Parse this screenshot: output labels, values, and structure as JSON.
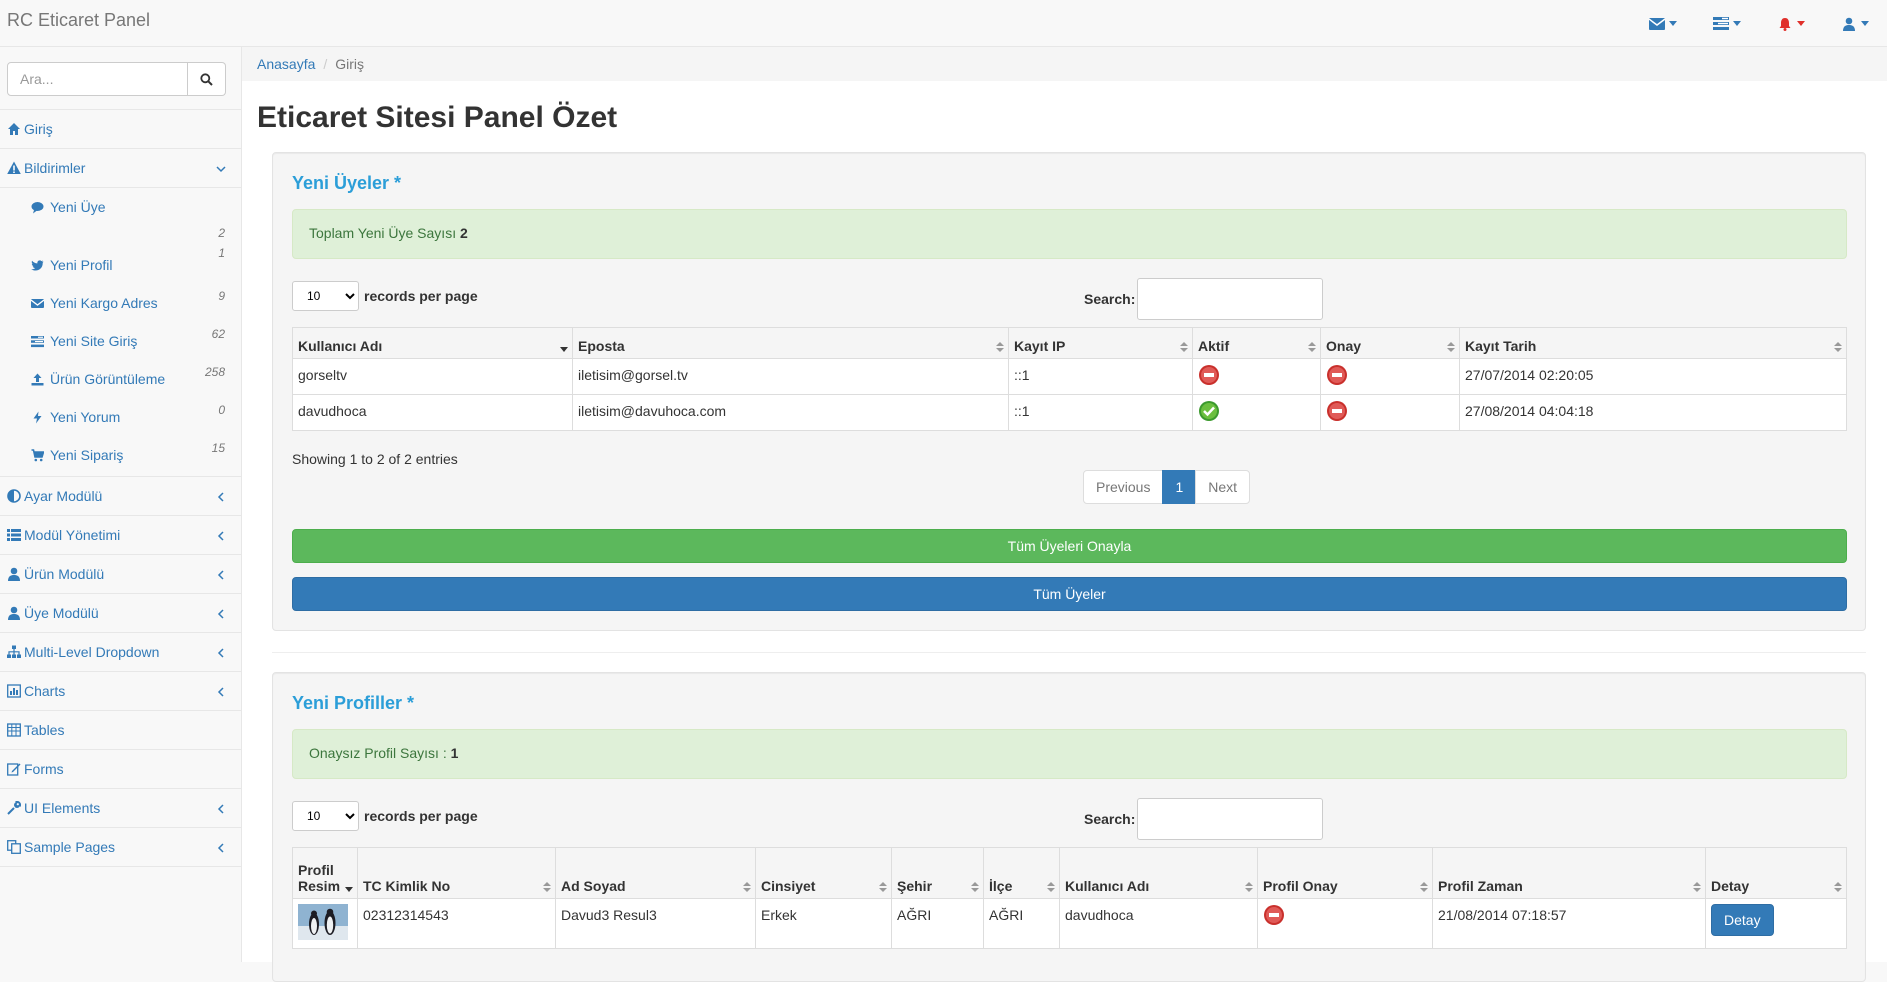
{
  "app": {
    "title": "RC Eticaret Panel"
  },
  "colors": {
    "accent": "#337ab7",
    "success": "#5cb85c",
    "danger": "#d9534f",
    "heading": "#2b9ed8"
  },
  "navbar_icons": [
    "envelope-icon",
    "tasks-icon",
    "bell-icon",
    "user-icon"
  ],
  "sidebar": {
    "search_placeholder": "Ara...",
    "items": [
      {
        "label": "Giriş",
        "icon": "home-icon"
      },
      {
        "label": "Bildirimler",
        "icon": "warning-icon",
        "expanded": true
      },
      {
        "label": "Ayar Modülü",
        "icon": "adjust-icon"
      },
      {
        "label": "Modül Yönetimi",
        "icon": "list-icon"
      },
      {
        "label": "Ürün Modülü",
        "icon": "user-icon"
      },
      {
        "label": "Üye Modülü",
        "icon": "user-icon"
      },
      {
        "label": "Multi-Level Dropdown",
        "icon": "sitemap-icon"
      },
      {
        "label": "Charts",
        "icon": "bar-chart-icon"
      },
      {
        "label": "Tables",
        "icon": "table-icon"
      },
      {
        "label": "Forms",
        "icon": "edit-icon"
      },
      {
        "label": "UI Elements",
        "icon": "wrench-icon"
      },
      {
        "label": "Sample Pages",
        "icon": "files-icon"
      }
    ],
    "notifications": [
      {
        "label": "Yeni Üye",
        "count": "2",
        "icon": "comment-icon"
      },
      {
        "label": "Yeni Profil",
        "count": "1",
        "icon": "twitter-icon"
      },
      {
        "label": "Yeni Kargo Adres",
        "count": "9",
        "icon": "envelope-icon"
      },
      {
        "label": "Yeni Site Giriş",
        "count": "62",
        "icon": "tasks-icon"
      },
      {
        "label": "Ürün Görüntüleme",
        "count": "258",
        "icon": "upload-icon"
      },
      {
        "label": "Yeni Yorum",
        "count": "0",
        "icon": "bolt-icon"
      },
      {
        "label": "Yeni Sipariş",
        "count": "15",
        "icon": "cart-icon"
      }
    ]
  },
  "breadcrumb": {
    "home": "Anasayfa",
    "current": "Giriş"
  },
  "page_title": "Eticaret Sitesi Panel Özet",
  "new_members": {
    "heading": "Yeni Üyeler *",
    "alert_text": "Toplam Yeni Üye Sayısı",
    "alert_count": "2",
    "length_value": "10",
    "length_label": "records per page",
    "search_label": "Search:",
    "columns": [
      "Kullanıcı Adı",
      "Eposta",
      "Kayıt IP",
      "Aktif",
      "Onay",
      "Kayıt Tarih"
    ],
    "rows": [
      {
        "user": "gorseltv",
        "email": "iletisim@gorsel.tv",
        "ip": "::1",
        "active": false,
        "approved": false,
        "date": "27/07/2014 02:20:05"
      },
      {
        "user": "davudhoca",
        "email": "iletisim@davuhoca.com",
        "ip": "::1",
        "active": true,
        "approved": false,
        "date": "27/08/2014 04:04:18"
      }
    ],
    "info": "Showing 1 to 2 of 2 entries",
    "pager": {
      "prev": "Previous",
      "page": "1",
      "next": "Next"
    },
    "approve_all": "Tüm Üyeleri Onayla",
    "all_members": "Tüm Üyeler"
  },
  "new_profiles": {
    "heading": "Yeni Profiller *",
    "alert_text": "Onaysız Profil Sayısı :",
    "alert_count": "1",
    "length_value": "10",
    "length_label": "records per page",
    "search_label": "Search:",
    "columns": [
      "Profil Resim",
      "TC Kimlik No",
      "Ad Soyad",
      "Cinsiyet",
      "Şehir",
      "İlçe",
      "Kullanıcı Adı",
      "Profil Onay",
      "Profil Zaman",
      "Detay"
    ],
    "rows": [
      {
        "tc": "02312314543",
        "name": "Davud3 Resul3",
        "gender": "Erkek",
        "city": "AĞRI",
        "district": "AĞRI",
        "user": "davudhoca",
        "approved": false,
        "time": "21/08/2014 07:18:57",
        "detail": "Detay"
      }
    ]
  }
}
